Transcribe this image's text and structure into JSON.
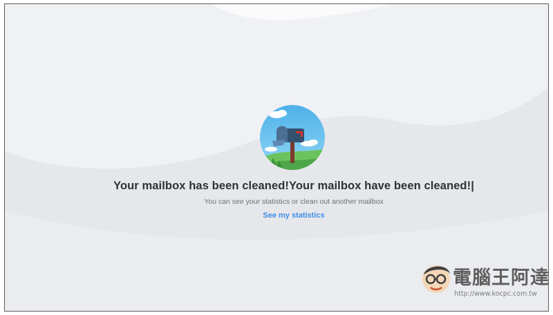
{
  "success": {
    "headline": "Your mailbox has been cleaned!Your mailbox have been cleaned!|",
    "subtext": "You can see your statistics or clean out another mailbox",
    "stats_link": "See my statistics",
    "illustration_icon": "mailbox-icon"
  },
  "watermark": {
    "title": "電腦王阿達",
    "url": "http://www.kocpc.com.tw"
  },
  "colors": {
    "background": "#e9eaee",
    "headline": "#2e3135",
    "subtext": "#6c6f75",
    "link": "#3d8ee8"
  }
}
